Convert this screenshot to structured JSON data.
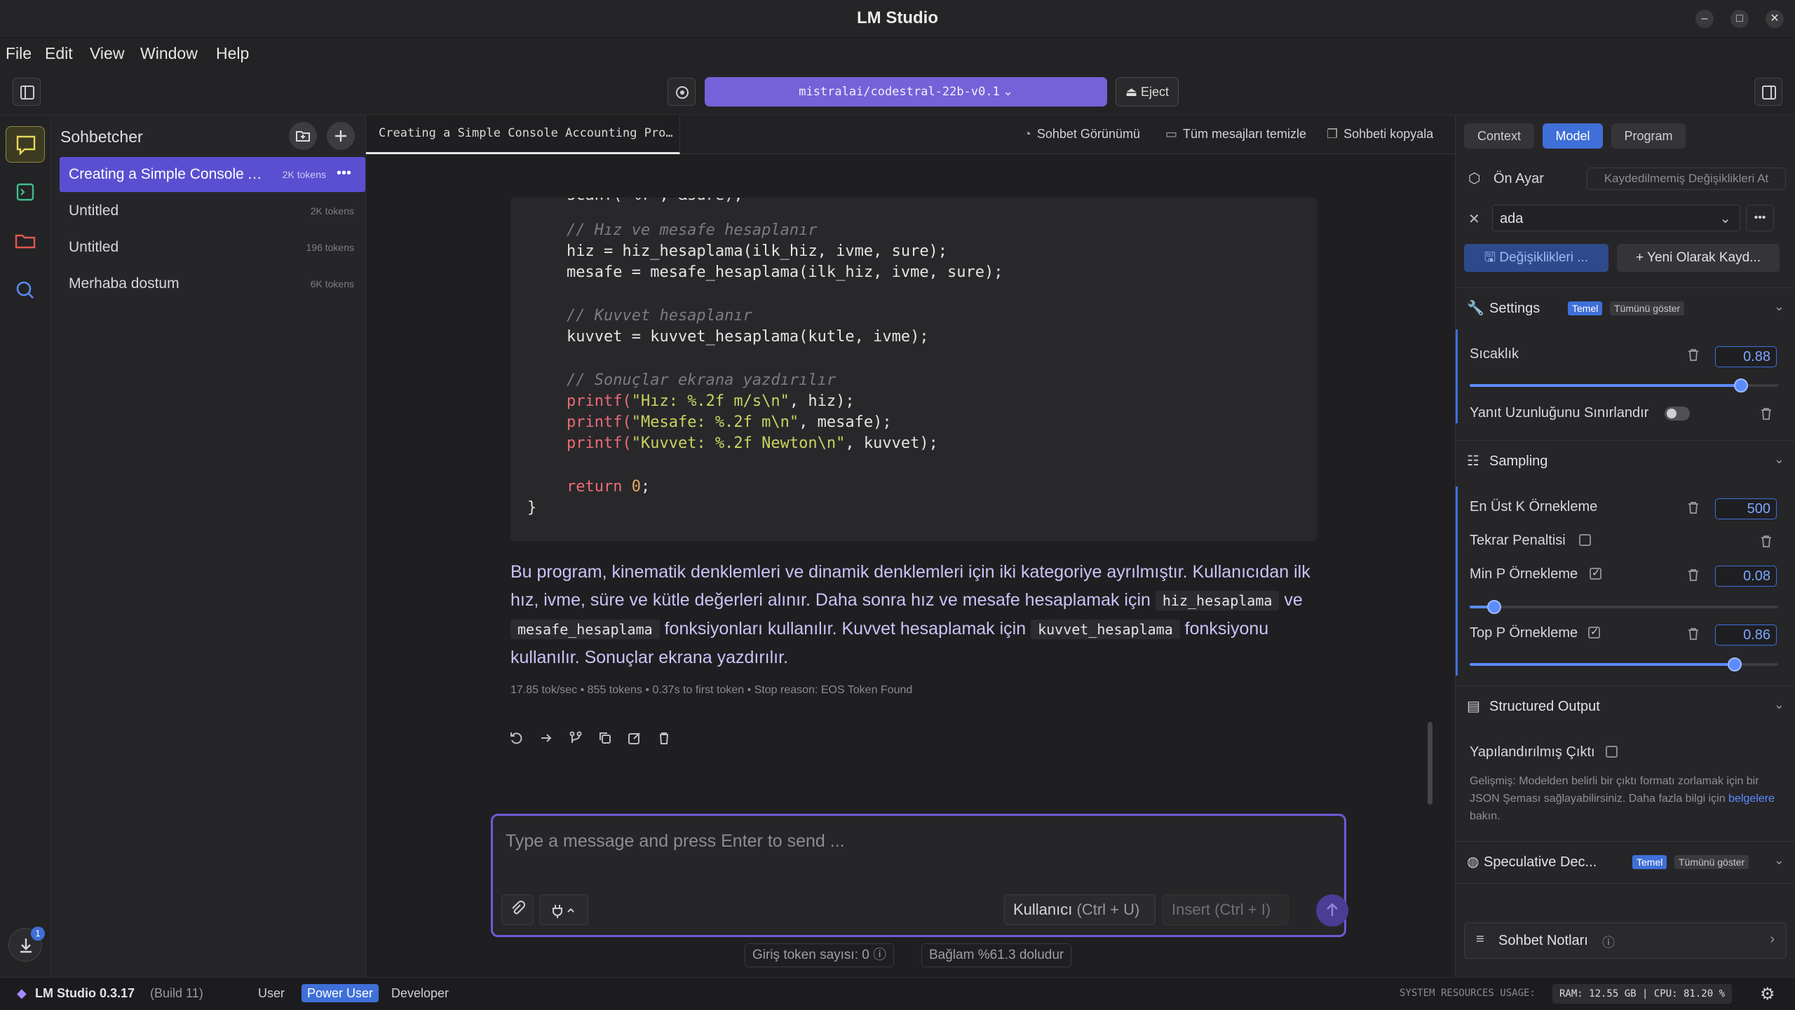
{
  "window": {
    "title": "LM Studio"
  },
  "menu": [
    "File",
    "Edit",
    "View",
    "Window",
    "Help"
  ],
  "toolbar": {
    "model": "mistralai/codestral-22b-v0.1",
    "eject": "Eject"
  },
  "chatlist": {
    "heading": "Sohbetcher",
    "items": [
      {
        "name": "Creating a Simple Console Accounting Program",
        "tokens": "2K tokens"
      },
      {
        "name": "Untitled",
        "tokens": "2K tokens"
      },
      {
        "name": "Untitled",
        "tokens": "196 tokens"
      },
      {
        "name": "Merhaba dostum",
        "tokens": "6K tokens"
      }
    ]
  },
  "main": {
    "tab": "Creating a Simple Console Accounting Pro…",
    "actions": {
      "view": "Sohbet Görünümü",
      "clear": "Tüm mesajları temizle",
      "copy": "Sohbeti kopyala"
    },
    "code": {
      "l0": "scanf(\"%f\", &sure);",
      "c1": "// Hız ve mesafe hesaplanır",
      "l1": "hiz = hiz_hesaplama(ilk_hiz, ivme, sure);",
      "l2": "mesafe = mesafe_hesaplama(ilk_hiz, ivme, sure);",
      "c2": "// Kuvvet hesaplanır",
      "l3": "kuvvet = kuvvet_hesaplama(kutle, ivme);",
      "c3": "// Sonuçlar ekrana yazdırılır",
      "p1": "printf(",
      "p1s": "\"Hız: %.2f m/s\\n\"",
      "p1e": ", hiz);",
      "p2s": "\"Mesafe: %.2f m\\n\"",
      "p2e": ", mesafe);",
      "p3s": "\"Kuvvet: %.2f Newton\\n\"",
      "p3e": ", kuvvet);",
      "ret": "return",
      "zero": "0",
      "semi": ";",
      "brace": "}"
    },
    "answer": {
      "t1": "Bu program, kinematik denklemleri ve dinamik denklemleri için iki kategoriye ayrılmıştır. Kullanıcıdan ilk hız, ivme, süre ve kütle değerleri alınır. Daha sonra hız ve mesafe hesaplamak için ",
      "c1": "hiz_hesaplama",
      "t2": " ve ",
      "c2": "mesafe_hesaplama",
      "t3": " fonksiyonları kullanılır. Kuvvet hesaplamak için ",
      "c3": "kuvvet_hesaplama",
      "t4": " fonksiyonu kullanılır. Sonuçlar ekrana yazdırılır."
    },
    "stats": "17.85 tok/sec • 855 tokens • 0.37s to first token • Stop reason: EOS Token Found",
    "input": {
      "placeholder": "Type a message and press Enter to send ...",
      "user_btn": "Kullanıcı",
      "user_shortcut": "(Ctrl + U)",
      "insert_btn": "Insert (Ctrl + I)"
    },
    "footer": {
      "tokens_label": "Giriş token sayısı:",
      "tokens_value": "0",
      "context": "Bağlam %61.3 doludur"
    }
  },
  "right": {
    "tabs": [
      "Context",
      "Model",
      "Program"
    ],
    "preset_label": "Ön Ayar",
    "unsaved": "Kaydedilmemiş Değişiklikleri At",
    "preset_value": "ada",
    "save_changes": "Değişiklikleri ...",
    "save_new": "Yeni Olarak Kayd...",
    "settings": {
      "label": "Settings",
      "badge_basic": "Temel",
      "badge_all": "Tümünü göster"
    },
    "temperature": {
      "label": "Sıcaklık",
      "value": "0.88",
      "fraction": 0.88
    },
    "limit_length": "Yanıt Uzunluğunu Sınırlandır",
    "sampling": {
      "label": "Sampling"
    },
    "topk": {
      "label": "En Üst K Örnekleme",
      "value": "500"
    },
    "repeat": {
      "label": "Tekrar Penaltisi"
    },
    "minp": {
      "label": "Min P Örnekleme",
      "value": "0.08",
      "fraction": 0.08
    },
    "topp": {
      "label": "Top P Örnekleme",
      "value": "0.86",
      "fraction": 0.86
    },
    "structured": {
      "label": "Structured Output",
      "field": "Yapılandırılmış Çıktı",
      "help1": "Gelişmiş: Modelden belirli bir çıktı formatı zorlamak için bir JSON Şeması sağlayabilirsiniz. Daha fazla bilgi için ",
      "link": "belgelere",
      "help2": " bakın."
    },
    "speculative": {
      "label": "Speculative Dec...",
      "badge_basic": "Temel",
      "badge_all": "Tümünü göster"
    },
    "notes": "Sohbet Notları"
  },
  "status": {
    "app": "LM Studio 0.3.17",
    "build": "(Build 11)",
    "modes": [
      "User",
      "Power User",
      "Developer"
    ],
    "usage_label": "SYSTEM RESOURCES USAGE:",
    "usage": "RAM: 12.55 GB | CPU: 81.20 %",
    "download_count": "1"
  },
  "colors": {
    "accent": "#7561d8",
    "selection": "#5b4fd1",
    "blue": "#3f6fd8"
  }
}
